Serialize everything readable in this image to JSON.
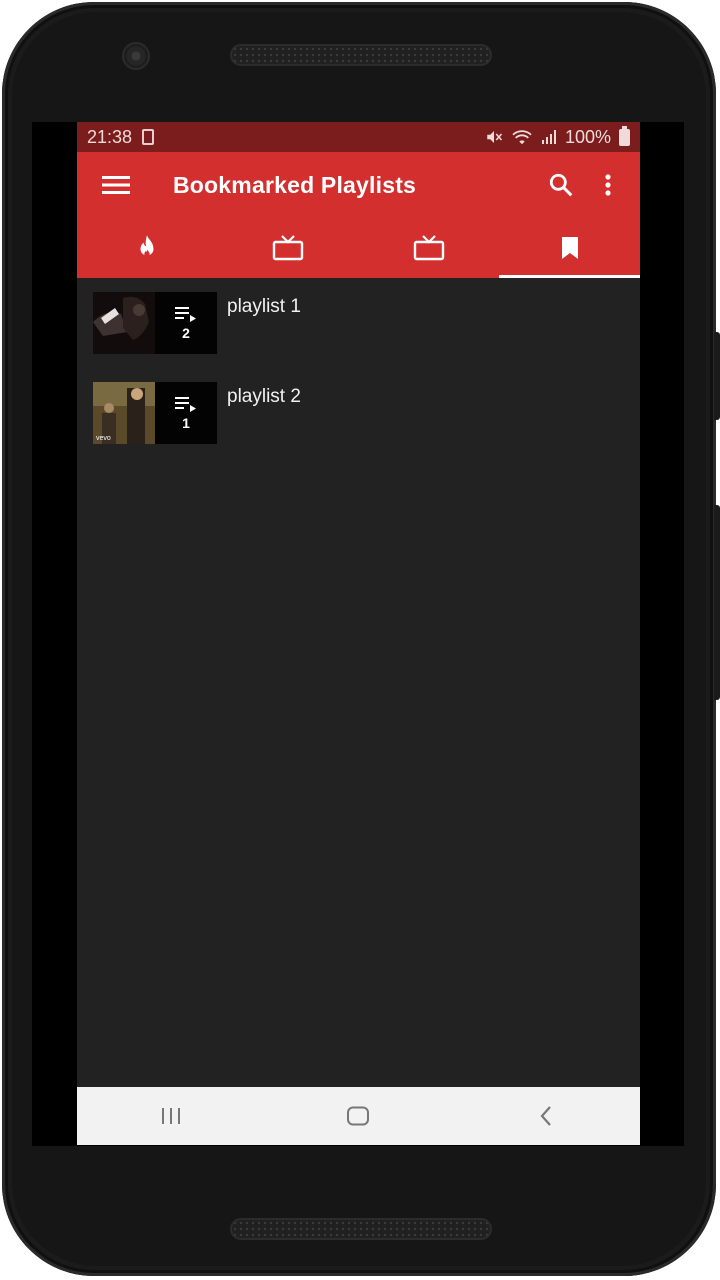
{
  "status_bar": {
    "time": "21:38",
    "battery": "100%",
    "icons": [
      "storage-icon",
      "mute-icon",
      "wifi-icon",
      "signal-icon",
      "battery-icon"
    ]
  },
  "app_bar": {
    "title": "Bookmarked Playlists",
    "color": "#d32f2f",
    "icons": [
      "menu-icon",
      "search-icon",
      "more-vert-icon"
    ]
  },
  "tabs": [
    {
      "icon": "fire-icon",
      "active": false
    },
    {
      "icon": "tv-icon",
      "active": false
    },
    {
      "icon": "tv-icon",
      "active": false
    },
    {
      "icon": "bookmark-icon",
      "active": true
    }
  ],
  "playlists": [
    {
      "title": "playlist 1",
      "count": "2"
    },
    {
      "title": "playlist 2",
      "count": "1"
    }
  ],
  "nav_bar": {
    "icons": [
      "recents-icon",
      "home-icon",
      "back-icon"
    ]
  },
  "colors": {
    "accent": "#d32f2f",
    "status_bar": "#7a1d1c",
    "background": "#222222",
    "nav_bar": "#f2f2f2"
  }
}
